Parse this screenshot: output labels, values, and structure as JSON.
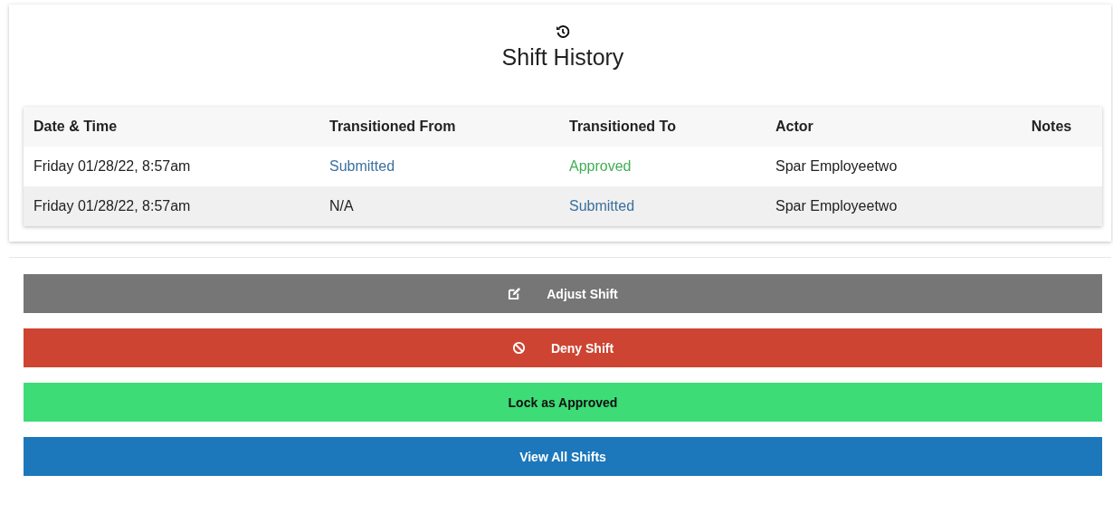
{
  "header": {
    "title": "Shift History"
  },
  "table": {
    "columns": [
      "Date & Time",
      "Transitioned From",
      "Transitioned To",
      "Actor",
      "Notes"
    ],
    "rows": [
      {
        "cells": [
          {
            "text": "Friday 01/28/22, 8:57am",
            "kind": "plain"
          },
          {
            "text": "Submitted",
            "kind": "submitted"
          },
          {
            "text": "Approved",
            "kind": "approved"
          },
          {
            "text": "Spar Employeetwo",
            "kind": "plain"
          }
        ]
      },
      {
        "cells": [
          {
            "text": "Friday 01/28/22, 8:57am",
            "kind": "plain"
          },
          {
            "text": "N/A",
            "kind": "plain"
          },
          {
            "text": "Submitted",
            "kind": "submitted"
          },
          {
            "text": "Spar Employeetwo",
            "kind": "plain"
          }
        ]
      }
    ]
  },
  "buttons": [
    {
      "label": "Adjust Shift",
      "kind": "adjust"
    },
    {
      "label": "Deny Shift",
      "kind": "deny"
    },
    {
      "label": "Lock as Approved",
      "kind": "lock"
    },
    {
      "label": "View All Shifts",
      "kind": "view"
    }
  ]
}
